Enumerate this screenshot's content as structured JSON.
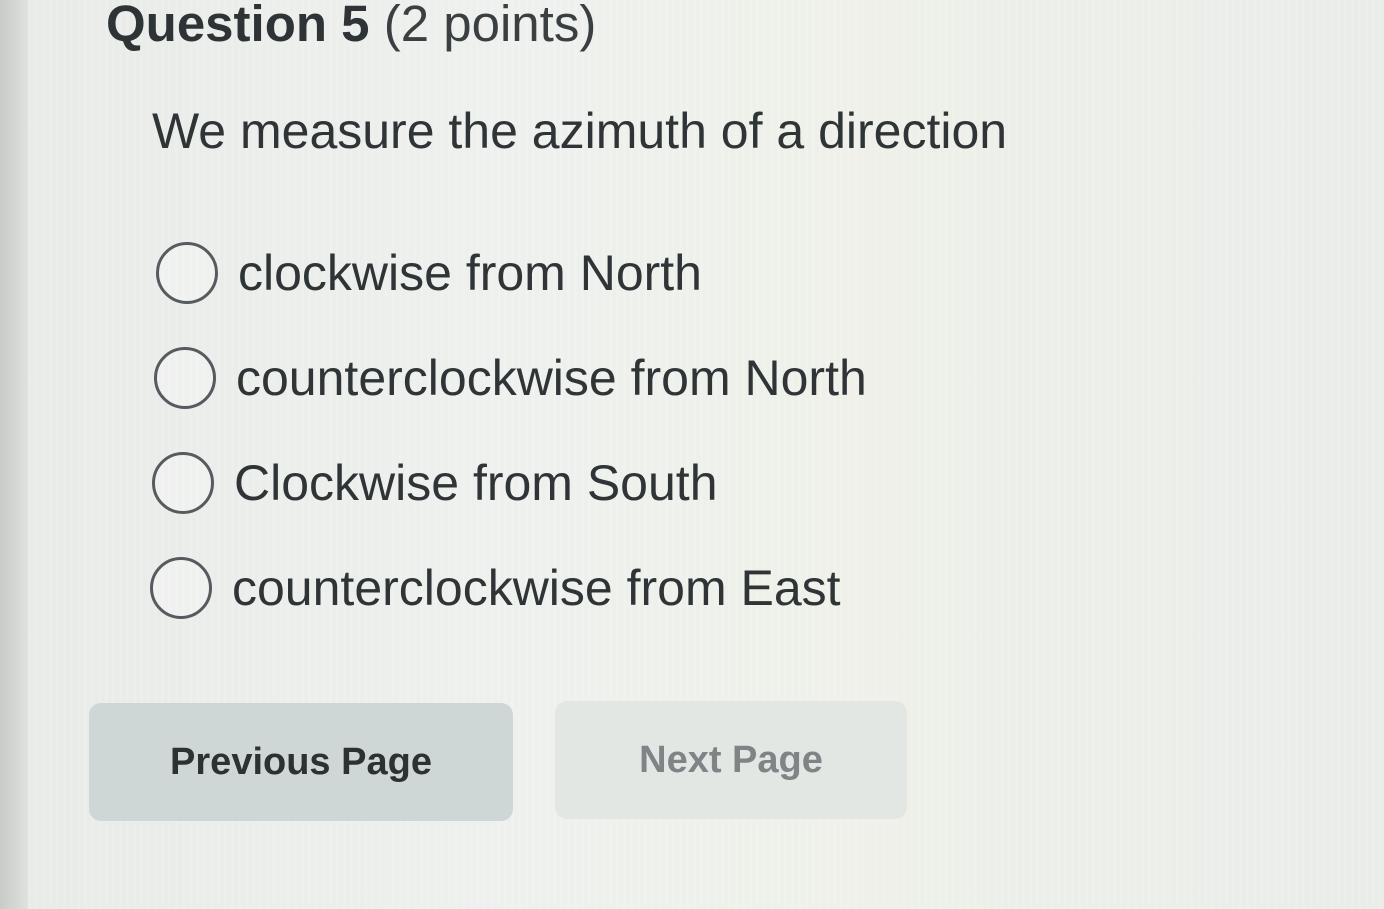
{
  "question": {
    "number_label": "Question 5",
    "points_label": "(2 points)",
    "prompt": "We measure the azimuth of a direction",
    "options": [
      {
        "label": "clockwise from North",
        "selected": false
      },
      {
        "label": "counterclockwise from North",
        "selected": false
      },
      {
        "label": "Clockwise from South",
        "selected": false
      },
      {
        "label": "counterclockwise from East",
        "selected": false
      }
    ]
  },
  "navigation": {
    "previous_label": "Previous Page",
    "next_label": "Next Page"
  }
}
